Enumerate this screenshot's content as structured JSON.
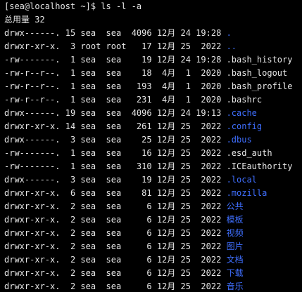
{
  "prompt": "[sea@localhost ~]$ ls -l -a",
  "total": "总用量 32",
  "entries": [
    {
      "perm": "drwx------.",
      "links": "15",
      "owner": "sea",
      "group": "sea",
      "size": "4096",
      "month": "12月",
      "day": "24",
      "time": "19:28",
      "name": ".",
      "is_dir": true
    },
    {
      "perm": "drwxr-xr-x.",
      "links": "3",
      "owner": "root",
      "group": "root",
      "size": "17",
      "month": "12月",
      "day": "25",
      "time": "2022",
      "name": "..",
      "is_dir": true
    },
    {
      "perm": "-rw-------.",
      "links": "1",
      "owner": "sea",
      "group": "sea",
      "size": "19",
      "month": "12月",
      "day": "24",
      "time": "19:28",
      "name": ".bash_history",
      "is_dir": false
    },
    {
      "perm": "-rw-r--r--.",
      "links": "1",
      "owner": "sea",
      "group": "sea",
      "size": "18",
      "month": "4月",
      "day": "1",
      "time": "2020",
      "name": ".bash_logout",
      "is_dir": false
    },
    {
      "perm": "-rw-r--r--.",
      "links": "1",
      "owner": "sea",
      "group": "sea",
      "size": "193",
      "month": "4月",
      "day": "1",
      "time": "2020",
      "name": ".bash_profile",
      "is_dir": false
    },
    {
      "perm": "-rw-r--r--.",
      "links": "1",
      "owner": "sea",
      "group": "sea",
      "size": "231",
      "month": "4月",
      "day": "1",
      "time": "2020",
      "name": ".bashrc",
      "is_dir": false
    },
    {
      "perm": "drwx------.",
      "links": "19",
      "owner": "sea",
      "group": "sea",
      "size": "4096",
      "month": "12月",
      "day": "24",
      "time": "19:13",
      "name": ".cache",
      "is_dir": true
    },
    {
      "perm": "drwxr-xr-x.",
      "links": "14",
      "owner": "sea",
      "group": "sea",
      "size": "261",
      "month": "12月",
      "day": "25",
      "time": "2022",
      "name": ".config",
      "is_dir": true
    },
    {
      "perm": "drwx------.",
      "links": "3",
      "owner": "sea",
      "group": "sea",
      "size": "25",
      "month": "12月",
      "day": "25",
      "time": "2022",
      "name": ".dbus",
      "is_dir": true
    },
    {
      "perm": "-rw-------.",
      "links": "1",
      "owner": "sea",
      "group": "sea",
      "size": "16",
      "month": "12月",
      "day": "25",
      "time": "2022",
      "name": ".esd_auth",
      "is_dir": false
    },
    {
      "perm": "-rw-------.",
      "links": "1",
      "owner": "sea",
      "group": "sea",
      "size": "310",
      "month": "12月",
      "day": "25",
      "time": "2022",
      "name": ".ICEauthority",
      "is_dir": false
    },
    {
      "perm": "drwx------.",
      "links": "3",
      "owner": "sea",
      "group": "sea",
      "size": "19",
      "month": "12月",
      "day": "25",
      "time": "2022",
      "name": ".local",
      "is_dir": true
    },
    {
      "perm": "drwxr-xr-x.",
      "links": "6",
      "owner": "sea",
      "group": "sea",
      "size": "81",
      "month": "12月",
      "day": "25",
      "time": "2022",
      "name": ".mozilla",
      "is_dir": true
    },
    {
      "perm": "drwxr-xr-x.",
      "links": "2",
      "owner": "sea",
      "group": "sea",
      "size": "6",
      "month": "12月",
      "day": "25",
      "time": "2022",
      "name": "公共",
      "is_dir": true
    },
    {
      "perm": "drwxr-xr-x.",
      "links": "2",
      "owner": "sea",
      "group": "sea",
      "size": "6",
      "month": "12月",
      "day": "25",
      "time": "2022",
      "name": "模板",
      "is_dir": true
    },
    {
      "perm": "drwxr-xr-x.",
      "links": "2",
      "owner": "sea",
      "group": "sea",
      "size": "6",
      "month": "12月",
      "day": "25",
      "time": "2022",
      "name": "视频",
      "is_dir": true
    },
    {
      "perm": "drwxr-xr-x.",
      "links": "2",
      "owner": "sea",
      "group": "sea",
      "size": "6",
      "month": "12月",
      "day": "25",
      "time": "2022",
      "name": "图片",
      "is_dir": true
    },
    {
      "perm": "drwxr-xr-x.",
      "links": "2",
      "owner": "sea",
      "group": "sea",
      "size": "6",
      "month": "12月",
      "day": "25",
      "time": "2022",
      "name": "文档",
      "is_dir": true
    },
    {
      "perm": "drwxr-xr-x.",
      "links": "2",
      "owner": "sea",
      "group": "sea",
      "size": "6",
      "month": "12月",
      "day": "25",
      "time": "2022",
      "name": "下载",
      "is_dir": true
    },
    {
      "perm": "drwxr-xr-x.",
      "links": "2",
      "owner": "sea",
      "group": "sea",
      "size": "6",
      "month": "12月",
      "day": "25",
      "time": "2022",
      "name": "音乐",
      "is_dir": true
    }
  ],
  "colors": {
    "background": "#000000",
    "text": "#e6e6e6",
    "directory": "#3f6fff"
  }
}
